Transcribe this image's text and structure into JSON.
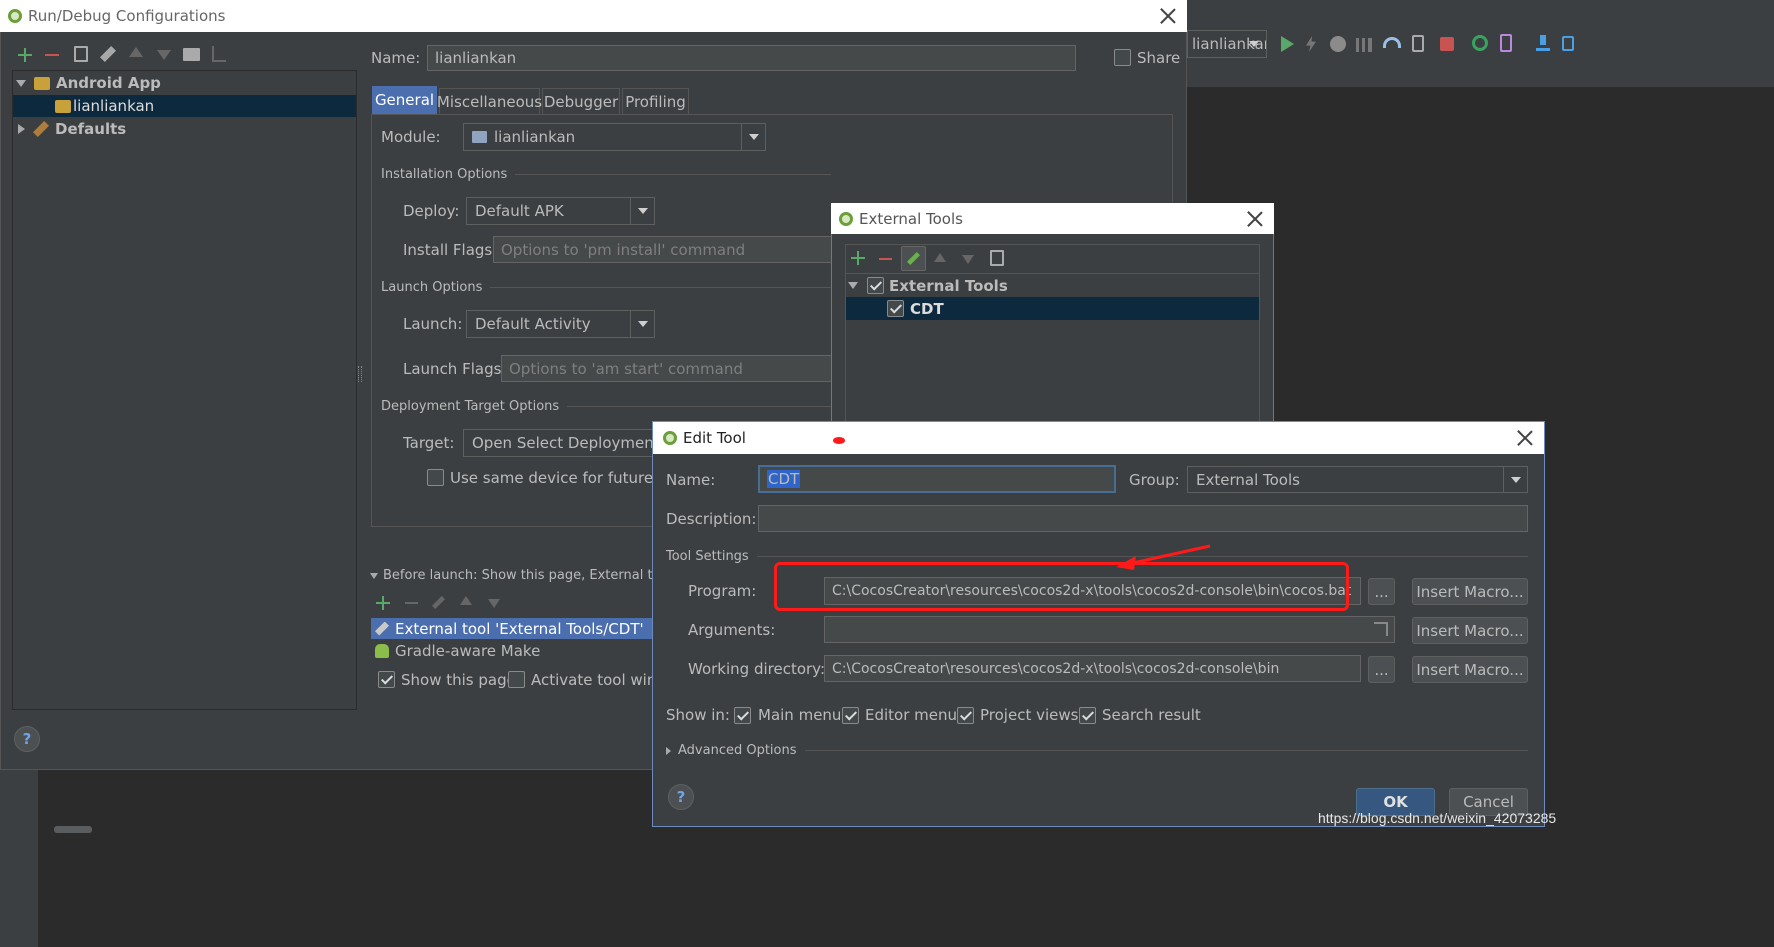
{
  "ide": {
    "run_config_selector": "lianliankan",
    "watermark": "https://blog.csdn.net/weixin_42073285"
  },
  "run_debug": {
    "title": "Run/Debug Configurations",
    "tree": {
      "android_app": "Android App",
      "lianliankan": "lianliankan",
      "defaults": "Defaults"
    },
    "name_label": "Name:",
    "name_value": "lianliankan",
    "share_label": "Share",
    "tabs": [
      "General",
      "Miscellaneous",
      "Debugger",
      "Profiling"
    ],
    "module_label": "Module:",
    "module_value": "lianliankan",
    "installation_options": "Installation Options",
    "deploy_label": "Deploy:",
    "deploy_value": "Default APK",
    "install_flags_label": "Install Flags:",
    "install_flags_placeholder": "Options to 'pm install' command",
    "launch_options": "Launch Options",
    "launch_label": "Launch:",
    "launch_value": "Default Activity",
    "launch_flags_label": "Launch Flags:",
    "launch_flags_placeholder": "Options to 'am start' command",
    "deployment_target_options": "Deployment Target Options",
    "target_label": "Target:",
    "target_value": "Open Select Deployment Ta",
    "same_device_label": "Use same device for future laun",
    "before_launch_label": "Before launch: Show this page, External tool,",
    "before_launch_items": [
      "External tool 'External Tools/CDT'",
      "Gradle-aware Make"
    ],
    "show_this_page": "Show this page",
    "activate_tool_window": "Activate tool windo",
    "help": "?"
  },
  "external_tools": {
    "title": "External Tools",
    "group": "External Tools",
    "item": "CDT"
  },
  "edit_tool": {
    "title": "Edit Tool",
    "name_label": "Name:",
    "name_value": "CDT",
    "group_label": "Group:",
    "group_value": "External Tools",
    "description_label": "Description:",
    "description_value": "",
    "tool_settings": "Tool Settings",
    "program_label": "Program:",
    "program_value": "C:\\CocosCreator\\resources\\cocos2d-x\\tools\\cocos2d-console\\bin\\cocos.bat",
    "arguments_label": "Arguments:",
    "arguments_value": "",
    "working_dir_label": "Working directory:",
    "working_dir_value": "C:\\CocosCreator\\resources\\cocos2d-x\\tools\\cocos2d-console\\bin",
    "browse": "...",
    "insert_macro": "Insert Macro...",
    "show_in_label": "Show in:",
    "show_in": [
      "Main menu",
      "Editor menu",
      "Project views",
      "Search result"
    ],
    "advanced_options": "Advanced Options",
    "ok": "OK",
    "cancel": "Cancel",
    "help": "?"
  },
  "colors": {
    "selection": "#0d293e",
    "selection_active": "#4b6eaf",
    "annotation_red": "#ff1a1a",
    "add_green": "#59a869",
    "remove_red": "#c75450"
  }
}
